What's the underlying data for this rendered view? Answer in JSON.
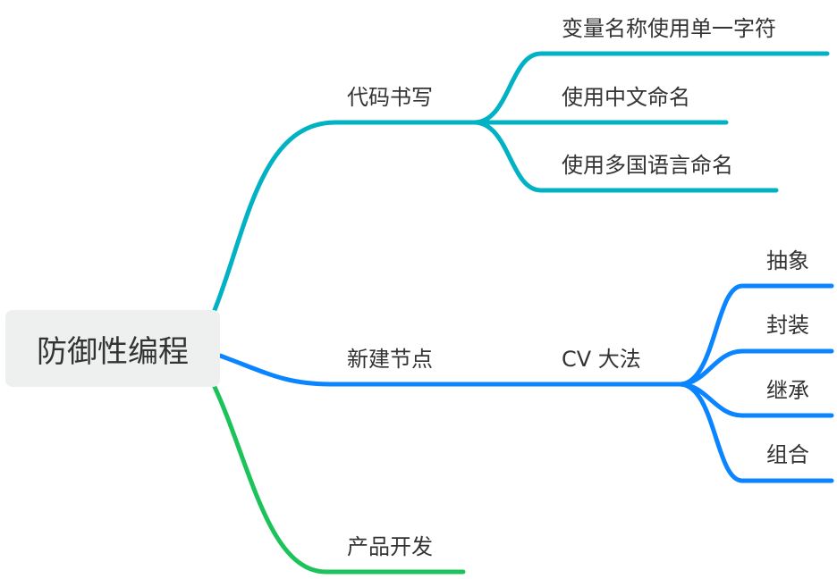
{
  "colors": {
    "branch_code": "#00b2c3",
    "branch_node": "#0a84ff",
    "branch_product": "#1cc35a",
    "root_bg": "#eef0f0",
    "text": "#333333"
  },
  "root": {
    "label": "防御性编程"
  },
  "branches": [
    {
      "label": "代码书写",
      "children": [
        {
          "label": "变量名称使用单一字符"
        },
        {
          "label": "使用中文命名"
        },
        {
          "label": "使用多国语言命名"
        }
      ]
    },
    {
      "label": "新建节点",
      "children": [
        {
          "label": "CV 大法",
          "children": [
            {
              "label": "抽象"
            },
            {
              "label": "封装"
            },
            {
              "label": "继承"
            },
            {
              "label": "组合"
            }
          ]
        }
      ]
    },
    {
      "label": "产品开发",
      "children": []
    }
  ]
}
